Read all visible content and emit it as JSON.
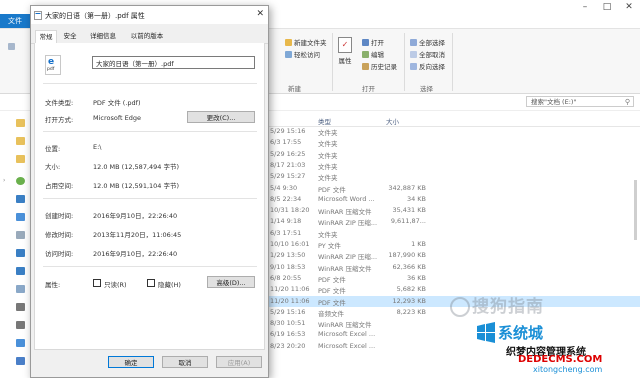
{
  "explorer": {
    "file_tab": "文件",
    "ribbon": {
      "items": [
        "新建文件夹",
        "轻松访问",
        "打开",
        "编辑",
        "历史记录",
        "全部选择",
        "全部取消",
        "反向选择"
      ],
      "properties_label": "属性",
      "groups": [
        "新建",
        "打开",
        "选择"
      ]
    },
    "search_placeholder": "搜索\"文档 (E:)\"",
    "columns": [
      "类型",
      "大小"
    ],
    "rows": [
      {
        "date": "5/29 15:16",
        "type": "文件夹",
        "size": ""
      },
      {
        "date": "6/3 17:55",
        "type": "文件夹",
        "size": ""
      },
      {
        "date": "5/29 16:25",
        "type": "文件夹",
        "size": ""
      },
      {
        "date": "8/17 21:03",
        "type": "文件夹",
        "size": ""
      },
      {
        "date": "5/29 15:27",
        "type": "文件夹",
        "size": ""
      },
      {
        "date": "5/4 9:30",
        "type": "PDF 文件",
        "size": "342,887 KB"
      },
      {
        "date": "8/5 22:34",
        "type": "Microsoft Word ...",
        "size": "34 KB"
      },
      {
        "date": "10/31 18:20",
        "type": "WinRAR 压缩文件",
        "size": "35,431 KB"
      },
      {
        "date": "1/14 9:18",
        "type": "WinRAR ZIP 压缩...",
        "size": "9,611,87..."
      },
      {
        "date": "6/3 17:51",
        "type": "文件夹",
        "size": ""
      },
      {
        "date": "10/10 16:01",
        "type": "PY 文件",
        "size": "1 KB"
      },
      {
        "date": "1/29 13:50",
        "type": "WinRAR ZIP 压缩...",
        "size": "187,990 KB"
      },
      {
        "date": "9/10 18:53",
        "type": "WinRAR 压缩文件",
        "size": "62,366 KB"
      },
      {
        "date": "6/8 20:55",
        "type": "PDF 文件",
        "size": "36 KB"
      },
      {
        "date": "11/20 11:06",
        "type": "PDF 文件",
        "size": "5,682 KB"
      },
      {
        "date": "11/20 11:06",
        "type": "PDF 文件",
        "size": "12,293 KB"
      },
      {
        "date": "5/29 15:16",
        "type": "音频文件",
        "size": "8,223 KB"
      },
      {
        "date": "8/30 10:51",
        "type": "WinRAR 压缩文件",
        "size": ""
      },
      {
        "date": "6/19 16:53",
        "type": "Microsoft Excel ...",
        "size": ""
      },
      {
        "date": "8/23 20:20",
        "type": "Microsoft Excel ...",
        "size": ""
      }
    ],
    "selected_row_index": 15,
    "watermarks": [
      "搜狗指南",
      "系统城",
      "织梦内容管理系统",
      "DEDECMS.COM",
      "xitongcheng.com"
    ]
  },
  "dialog": {
    "title": "大家的日语（第一册）.pdf 属性",
    "tabs": [
      "常规",
      "安全",
      "详细信息",
      "以前的版本"
    ],
    "active_tab": 0,
    "file_icon_label": "pdf",
    "file_name": "大家的日语（第一册）.pdf",
    "props": [
      {
        "label": "文件类型:",
        "value": "PDF 文件 (.pdf)"
      },
      {
        "label": "打开方式:",
        "value": "Microsoft Edge"
      },
      {
        "label": "位置:",
        "value": "E:\\"
      },
      {
        "label": "大小:",
        "value": "12.0 MB (12,587,494 字节)"
      },
      {
        "label": "占用空间:",
        "value": "12.0 MB (12,591,104 字节)"
      },
      {
        "label": "创建时间:",
        "value": "2016年9月10日，22:26:40"
      },
      {
        "label": "修改时间:",
        "value": "2013年11月20日，11:06:45"
      },
      {
        "label": "访问时间:",
        "value": "2016年9月10日，22:26:40"
      },
      {
        "label": "属性:",
        "value": ""
      }
    ],
    "change_button": "更改(C)...",
    "readonly_label": "只读(R)",
    "hidden_label": "隐藏(H)",
    "advanced_button": "高级(D)...",
    "ok_button": "确定",
    "cancel_button": "取消",
    "apply_button": "应用(A)"
  }
}
